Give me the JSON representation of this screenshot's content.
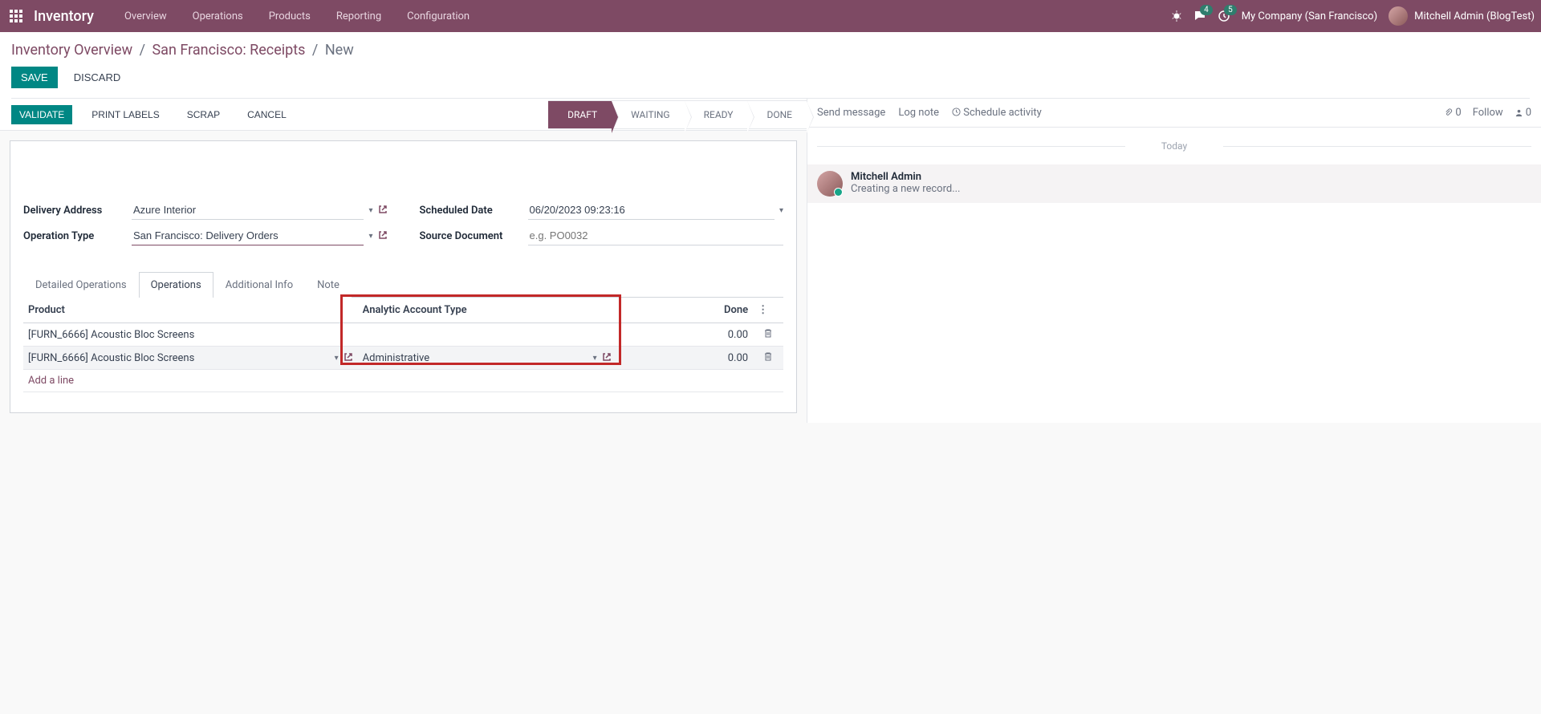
{
  "navbar": {
    "app": "Inventory",
    "menu": [
      "Overview",
      "Operations",
      "Products",
      "Reporting",
      "Configuration"
    ],
    "msg_badge": "4",
    "activity_badge": "5",
    "company": "My Company (San Francisco)",
    "user": "Mitchell Admin (BlogTest)"
  },
  "breadcrumb": {
    "root": "Inventory Overview",
    "parent": "San Francisco: Receipts",
    "current": "New"
  },
  "actions": {
    "save": "SAVE",
    "discard": "DISCARD"
  },
  "statusbar": {
    "validate": "VALIDATE",
    "print": "PRINT LABELS",
    "scrap": "SCRAP",
    "cancel": "CANCEL",
    "stages": [
      "DRAFT",
      "WAITING",
      "READY",
      "DONE"
    ],
    "active_stage": 0
  },
  "form": {
    "delivery_label": "Delivery Address",
    "delivery_value": "Azure Interior",
    "optype_label": "Operation Type",
    "optype_value": "San Francisco: Delivery Orders",
    "sched_label": "Scheduled Date",
    "sched_value": "06/20/2023 09:23:16",
    "source_label": "Source Document",
    "source_placeholder": "e.g. PO0032"
  },
  "tabs": [
    "Detailed Operations",
    "Operations",
    "Additional Info",
    "Note"
  ],
  "table": {
    "col_product": "Product",
    "col_analytic": "Analytic Account Type",
    "col_done": "Done",
    "rows": [
      {
        "product": "[FURN_6666] Acoustic Bloc Screens",
        "analytic": "",
        "done": "0.00",
        "editing": false
      },
      {
        "product": "[FURN_6666] Acoustic Bloc Screens",
        "analytic": "Administrative",
        "done": "0.00",
        "editing": true
      }
    ],
    "add_line": "Add a line"
  },
  "chatter": {
    "send": "Send message",
    "log": "Log note",
    "schedule": "Schedule activity",
    "attach_count": "0",
    "follow": "Follow",
    "follower_count": "0",
    "today": "Today",
    "entry_author": "Mitchell Admin",
    "entry_msg": "Creating a new record..."
  }
}
